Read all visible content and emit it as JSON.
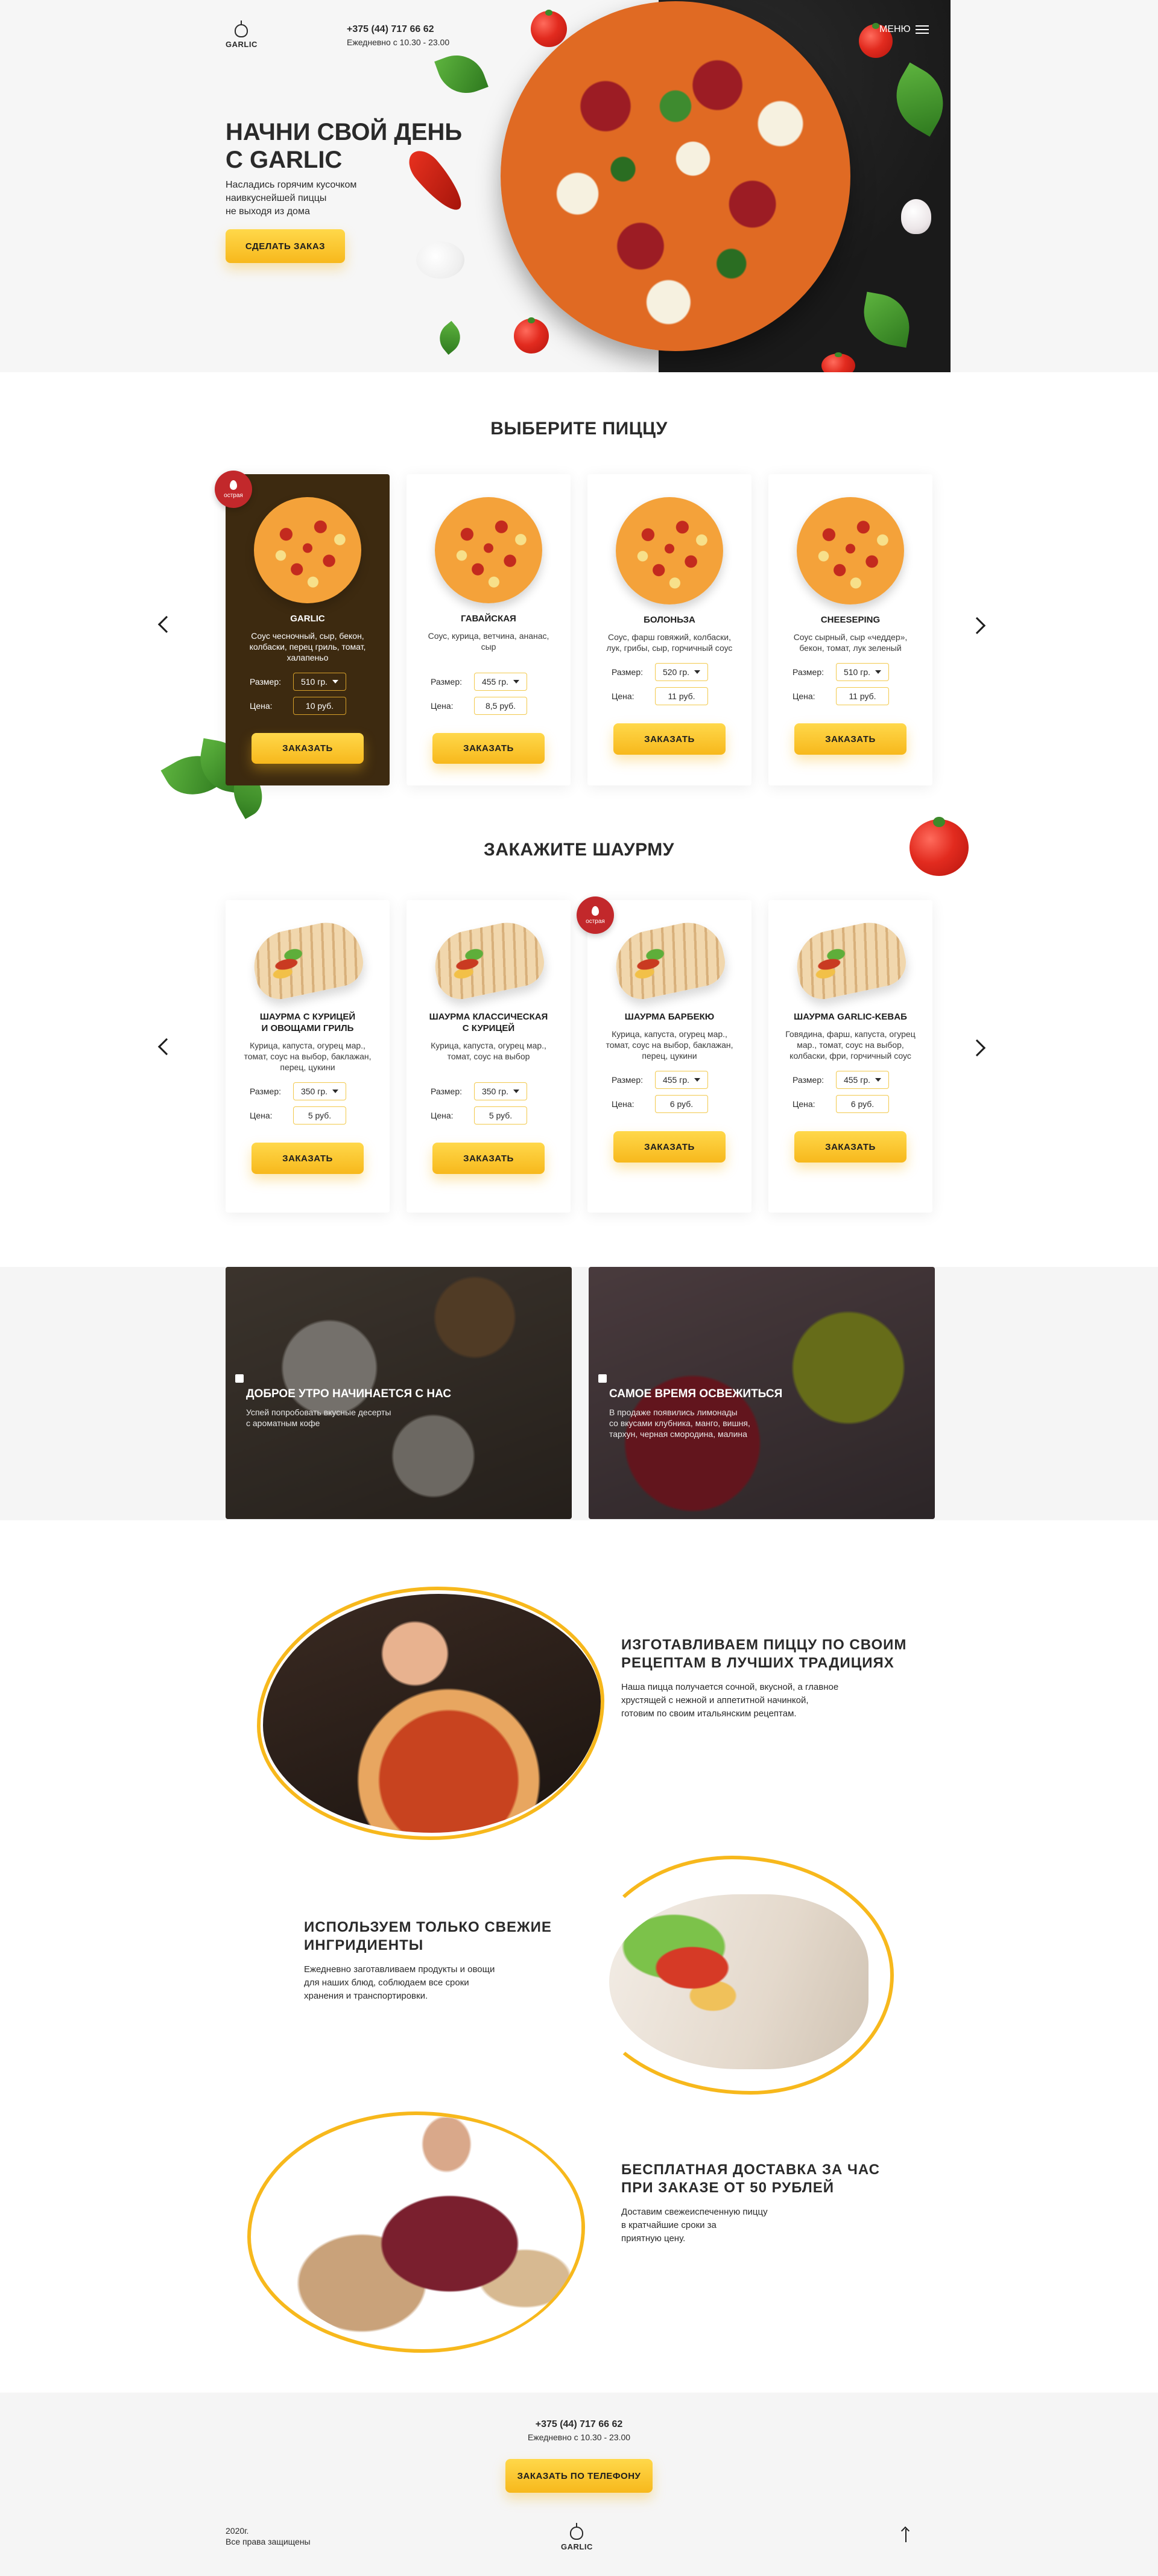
{
  "header": {
    "logo_text": "GARLIC",
    "phone": "+375 (44) 717 66 62",
    "hours": "Ежедневно с 10.30 - 23.00",
    "menu_label": "МЕНЮ"
  },
  "hero": {
    "title_line1": "НАЧНИ СВОЙ ДЕНЬ",
    "title_line2": "С GARLIC",
    "subtitle_line1": "Насладись горячим кусочком",
    "subtitle_line2": "наивкуснейшей пиццы",
    "subtitle_line3": "не выходя из дома",
    "order_button": "СДЕЛАТЬ ЗАКАЗ"
  },
  "pizza_section": {
    "title": "ВЫБЕРИТЕ ПИЦЦУ",
    "size_label": "Размер:",
    "price_label": "Цена:",
    "order_label": "ЗАКАЗАТЬ",
    "badge_label": "острая",
    "items": [
      {
        "name": "GARLIC",
        "desc": "Соус чесночный, сыр, бекон, колбаски, перец гриль, томат, халапеньо",
        "size": "510 гр.",
        "price": "10 руб.",
        "featured": true,
        "spicy": true
      },
      {
        "name": "ГАВАЙСКАЯ",
        "desc": "Соус, курица, ветчина, ананас, сыр",
        "size": "455 гр.",
        "price": "8,5 руб.",
        "featured": false,
        "spicy": false
      },
      {
        "name": "БОЛОНЬЗА",
        "desc": "Соус, фарш говяжий, колбаски, лук, грибы, сыр, горчичный соус",
        "size": "520 гр.",
        "price": "11 руб.",
        "featured": false,
        "spicy": false
      },
      {
        "name": "CHEESEPING",
        "desc": "Соус сырный, сыр «чеддер», бекон, томат, лук зеленый",
        "size": "510 гр.",
        "price": "11 руб.",
        "featured": false,
        "spicy": false
      }
    ]
  },
  "shawarma_section": {
    "title": "ЗАКАЖИТЕ ШАУРМУ",
    "size_label": "Размер:",
    "price_label": "Цена:",
    "order_label": "ЗАКАЗАТЬ",
    "badge_label": "острая",
    "items": [
      {
        "name_line1": "ШАУРМА С КУРИЦЕЙ",
        "name_line2": "И ОВОЩАМИ ГРИЛЬ",
        "desc": "Курица, капуста, огурец мар., томат, соус на выбор, баклажан, перец, цукини",
        "size": "350 гр.",
        "price": "5 руб.",
        "spicy": false
      },
      {
        "name_line1": "ШАУРМА КЛАССИЧЕСКАЯ",
        "name_line2": "С КУРИЦЕЙ",
        "desc": "Курица, капуста, огурец мар., томат, соус на выбор",
        "size": "350 гр.",
        "price": "5 руб.",
        "spicy": false
      },
      {
        "name_line1": "ШАУРМА БАРБЕКЮ",
        "name_line2": "",
        "desc": "Курица, капуста, огурец мар., томат, соус на выбор, баклажан, перец, цукини",
        "size": "455 гр.",
        "price": "6 руб.",
        "spicy": true
      },
      {
        "name_line1": "ШАУРМА GARLIC-KEBAБ",
        "name_line2": "",
        "desc": "Говядина, фарш, капуста, огурец мар., томат, соус на выбор, колбаски, фри, горчичный соус",
        "size": "455 гр.",
        "price": "6 руб.",
        "spicy": false
      }
    ]
  },
  "promos": [
    {
      "title": "ДОБРОЕ УТРО НАЧИНАЕТСЯ С НАС",
      "text_line1": "Успей попробовать вкусные десерты",
      "text_line2": "с ароматным кофе",
      "text_line3": ""
    },
    {
      "title": "САМОЕ ВРЕМЯ ОСВЕЖИТЬСЯ",
      "text_line1": "В продаже появились лимонады",
      "text_line2": "со вкусами клубника, манго, вишня,",
      "text_line3": "тархун, черная смородина, малина"
    }
  ],
  "features": [
    {
      "title_line1": "ИЗГОТАВЛИВАЕМ ПИЦЦУ ПО СВОИМ",
      "title_line2": "РЕЦЕПТАМ В ЛУЧШИХ ТРАДИЦИЯХ",
      "text_line1": "Наша пицца получается сочной, вкусной, а главное",
      "text_line2": "хрустящей с нежной и аппетитной начинкой,",
      "text_line3": "готовим по своим итальянским рецептам."
    },
    {
      "title_line1": "ИСПОЛЬЗУЕМ ТОЛЬКО СВЕЖИЕ",
      "title_line2": "ИНГРИДИЕНТЫ",
      "text_line1": "Ежедневно заготавливаем продукты и овощи",
      "text_line2": "для наших блюд, соблюдаем все сроки",
      "text_line3": "хранения и транспортировки."
    },
    {
      "title_line1": "БЕСПЛАТНАЯ ДОСТАВКА ЗА ЧАС",
      "title_line2": "ПРИ ЗАКАЗЕ ОТ 50 РУБЛЕЙ",
      "text_line1": "Доставим свежеиспеченную пиццу",
      "text_line2": "в кратчайшие сроки за",
      "text_line3": "приятную цену."
    }
  ],
  "footer": {
    "phone": "+375 (44) 717 66 62",
    "hours": "Ежедневно с 10.30 - 23.00",
    "order_button": "ЗАКАЗАТЬ ПО ТЕЛЕФОНУ",
    "copyright_line1": "2020г.",
    "copyright_line2": "Все права защищены",
    "logo_text": "GARLIC"
  },
  "colors": {
    "accent": "#f7b81c",
    "featured_card": "#3d2a10",
    "badge": "#c2282b",
    "text": "#2a2a2a"
  }
}
